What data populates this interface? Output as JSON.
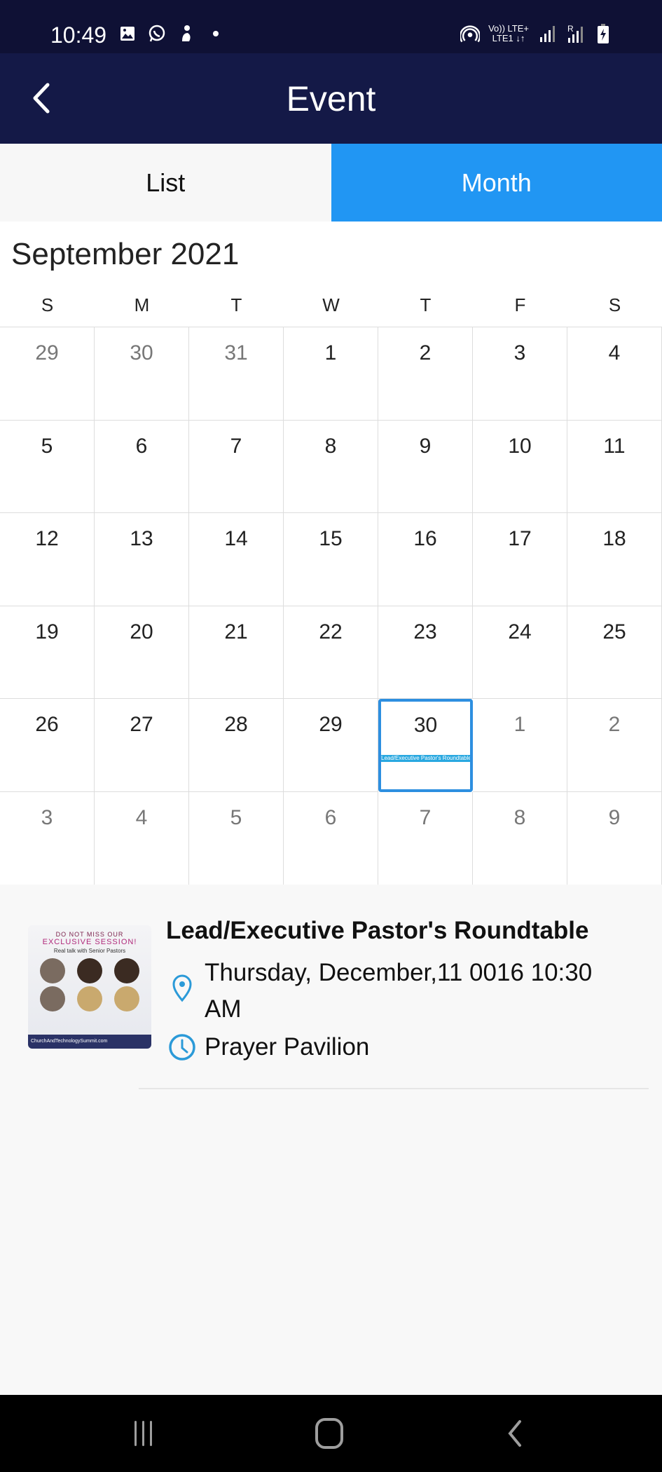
{
  "status_bar": {
    "time": "10:49",
    "left_icons": [
      "gallery-icon",
      "whatsapp-icon",
      "notification-icon",
      "dot-icon"
    ],
    "right_icons": [
      "hotspot-icon",
      "volte-lte-icon",
      "signal-icon",
      "roaming-signal-icon",
      "battery-charging-icon"
    ],
    "volte_label": "Vo)) LTE+",
    "lte1_label": "LTE1 ↓↑",
    "roaming_label": "R"
  },
  "app_bar": {
    "title": "Event",
    "back_icon": "chevron-left-icon"
  },
  "tabs": [
    {
      "label": "List",
      "active": false
    },
    {
      "label": "Month",
      "active": true
    }
  ],
  "calendar": {
    "month_title": "September 2021",
    "weekdays": [
      "S",
      "M",
      "T",
      "W",
      "T",
      "F",
      "S"
    ],
    "weeks": [
      [
        {
          "d": "29",
          "other": true
        },
        {
          "d": "30",
          "other": true
        },
        {
          "d": "31",
          "other": true
        },
        {
          "d": "1"
        },
        {
          "d": "2"
        },
        {
          "d": "3"
        },
        {
          "d": "4"
        }
      ],
      [
        {
          "d": "5"
        },
        {
          "d": "6"
        },
        {
          "d": "7"
        },
        {
          "d": "8"
        },
        {
          "d": "9"
        },
        {
          "d": "10"
        },
        {
          "d": "11"
        }
      ],
      [
        {
          "d": "12"
        },
        {
          "d": "13"
        },
        {
          "d": "14"
        },
        {
          "d": "15"
        },
        {
          "d": "16"
        },
        {
          "d": "17"
        },
        {
          "d": "18"
        }
      ],
      [
        {
          "d": "19"
        },
        {
          "d": "20"
        },
        {
          "d": "21"
        },
        {
          "d": "22"
        },
        {
          "d": "23"
        },
        {
          "d": "24"
        },
        {
          "d": "25"
        }
      ],
      [
        {
          "d": "26"
        },
        {
          "d": "27"
        },
        {
          "d": "28"
        },
        {
          "d": "29"
        },
        {
          "d": "30",
          "selected": true,
          "event": "Lead/Executive Pastor's Roundtable"
        },
        {
          "d": "1",
          "other": true
        },
        {
          "d": "2",
          "other": true
        }
      ],
      [
        {
          "d": "3",
          "other": true
        },
        {
          "d": "4",
          "other": true
        },
        {
          "d": "5",
          "other": true
        },
        {
          "d": "6",
          "other": true
        },
        {
          "d": "7",
          "other": true
        },
        {
          "d": "8",
          "other": true
        },
        {
          "d": "9",
          "other": true
        }
      ]
    ]
  },
  "event": {
    "title": "Lead/Executive Pastor's Roundtable",
    "datetime": "Thursday, December,11 0016 10:30 AM",
    "location": "Prayer Pavilion",
    "thumbnail": {
      "line1": "DO NOT MISS OUR",
      "line2": "EXCLUSIVE SESSION!",
      "line3": "Real talk with Senior Pastors",
      "footer": "ChurchAndTechnologySummit.com"
    }
  },
  "colors": {
    "status_bar": "#0f1135",
    "app_bar": "#141947",
    "accent": "#2196f3",
    "event_bar": "#29a8e0"
  },
  "nav_bar": [
    "recents-icon",
    "home-icon",
    "back-icon"
  ]
}
